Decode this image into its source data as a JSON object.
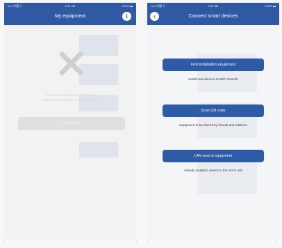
{
  "left_screen": {
    "status": {
      "carrier": "••••• 中国 ✦",
      "time": "9:41 AM",
      "battery": "100% ▬"
    },
    "title": "My equipment",
    "info_icon": "info-icon",
    "empty_message_line1": "There is no equipment, add device",
    "empty_message_line2": "Click the button below to add equipment",
    "add_button": "Add device"
  },
  "right_screen": {
    "status": {
      "carrier": "••••• 中国 ✦",
      "time": "9:41 AM",
      "battery": "100% ▬"
    },
    "title": "Connect smart devices",
    "back_icon": "back-icon",
    "options": [
      {
        "label": "First installation equipment",
        "caption": "Install new devices to WiFi network"
      },
      {
        "label": "Scan QR code",
        "caption": "Equipment to be shared by friends and relatives"
      },
      {
        "label": "LAN search equipment",
        "caption": "Already installed, search in the net to add"
      }
    ]
  },
  "colors": {
    "header": "#2f5aa3",
    "button": "#2e5ba8",
    "background": "#f4f5f7"
  }
}
